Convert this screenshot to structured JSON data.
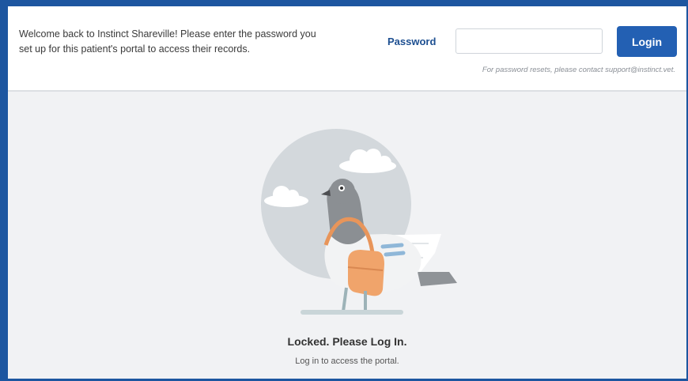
{
  "header": {
    "welcome_text": "Welcome back to Instinct Shareville! Please enter the password you set up for this patient's portal to access their records.",
    "password_label": "Password",
    "password_value": "",
    "login_label": "Login",
    "reset_note": "For password resets, please contact support@instinct.vet."
  },
  "main": {
    "illustration": "pigeon-with-satchel-icon",
    "locked_title": "Locked. Please Log In.",
    "locked_subtitle": "Log in to access the portal."
  },
  "colors": {
    "frame_border": "#1d56a0",
    "accent": "#2360b3",
    "label": "#1d4f91",
    "background": "#f1f2f4"
  }
}
